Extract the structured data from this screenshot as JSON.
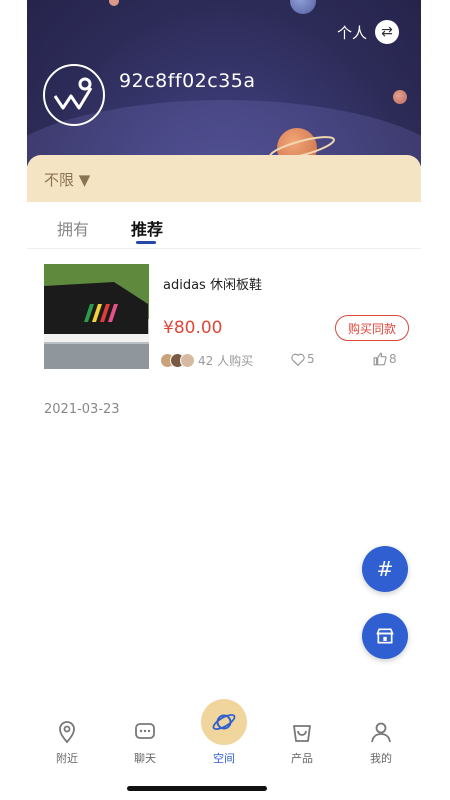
{
  "header": {
    "switch_label": "个人",
    "switch_icon": "swap-icon",
    "user_id": "92c8ff02c35a"
  },
  "filter": {
    "label": "不限 ▼"
  },
  "tabs": [
    {
      "label": "拥有",
      "active": false
    },
    {
      "label": "推荐",
      "active": true
    }
  ],
  "product": {
    "name": "adidas 休闲板鞋",
    "price": "¥80.00",
    "buy_button": "购买同款",
    "buyers_text": "42 人购买",
    "likes": "5",
    "thumbs_up": "8"
  },
  "date": "2021-03-23",
  "fabs": {
    "hash_icon": "#",
    "shop_icon": "store-icon"
  },
  "bottom_nav": [
    {
      "label": "附近",
      "icon": "location-pin-icon"
    },
    {
      "label": "聊天",
      "icon": "chat-bubble-icon"
    },
    {
      "label": "空间",
      "icon": "planet-icon",
      "active": true
    },
    {
      "label": "产品",
      "icon": "bag-icon"
    },
    {
      "label": "我的",
      "icon": "person-icon"
    }
  ],
  "colors": {
    "accent": "#2f5fd0",
    "price": "#e0473a",
    "filter_bg": "#f5e4c3",
    "nav_center": "#f0d59c"
  }
}
